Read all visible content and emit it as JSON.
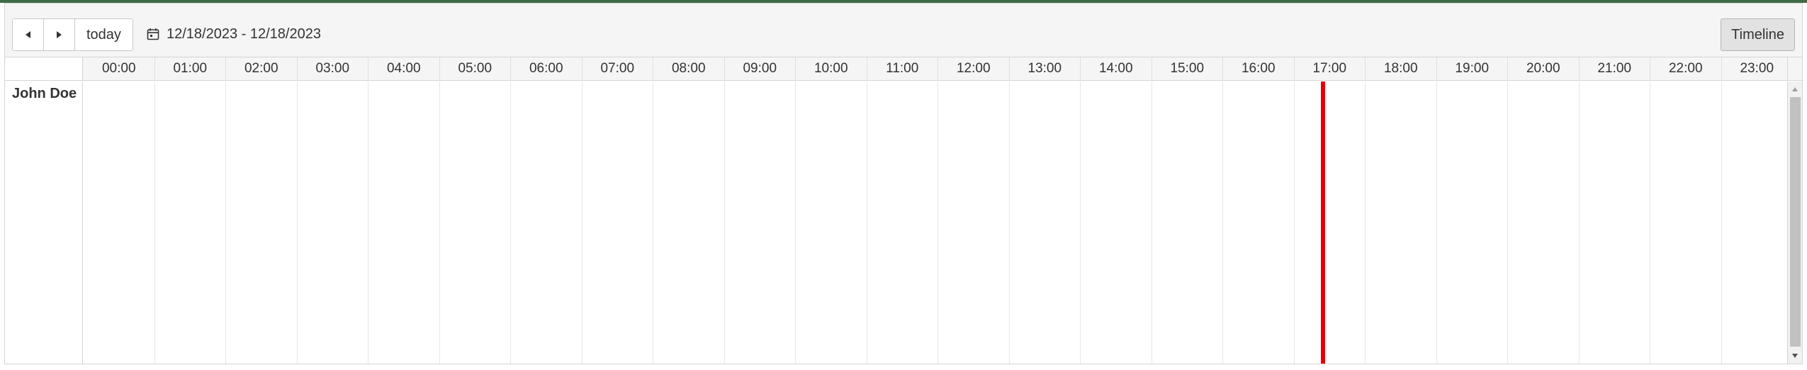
{
  "toolbar": {
    "prev_icon": "caret-left-icon",
    "next_icon": "caret-right-icon",
    "today_label": "today",
    "date_range": "12/18/2023 - 12/18/2023",
    "calendar_icon": "calendar-icon",
    "view_label": "Timeline"
  },
  "timeline": {
    "hours": [
      "00:00",
      "01:00",
      "02:00",
      "03:00",
      "04:00",
      "05:00",
      "06:00",
      "07:00",
      "08:00",
      "09:00",
      "10:00",
      "11:00",
      "12:00",
      "13:00",
      "14:00",
      "15:00",
      "16:00",
      "17:00",
      "18:00",
      "19:00",
      "20:00",
      "21:00",
      "22:00",
      "23:00"
    ],
    "resources": [
      {
        "name": "John Doe"
      }
    ],
    "current_time_hour": 17.4,
    "now_line_color": "#e60000"
  },
  "colors": {
    "accent_top": "#3f6b44",
    "header_bg": "#f5f5f5",
    "border": "#d5d5d5"
  }
}
